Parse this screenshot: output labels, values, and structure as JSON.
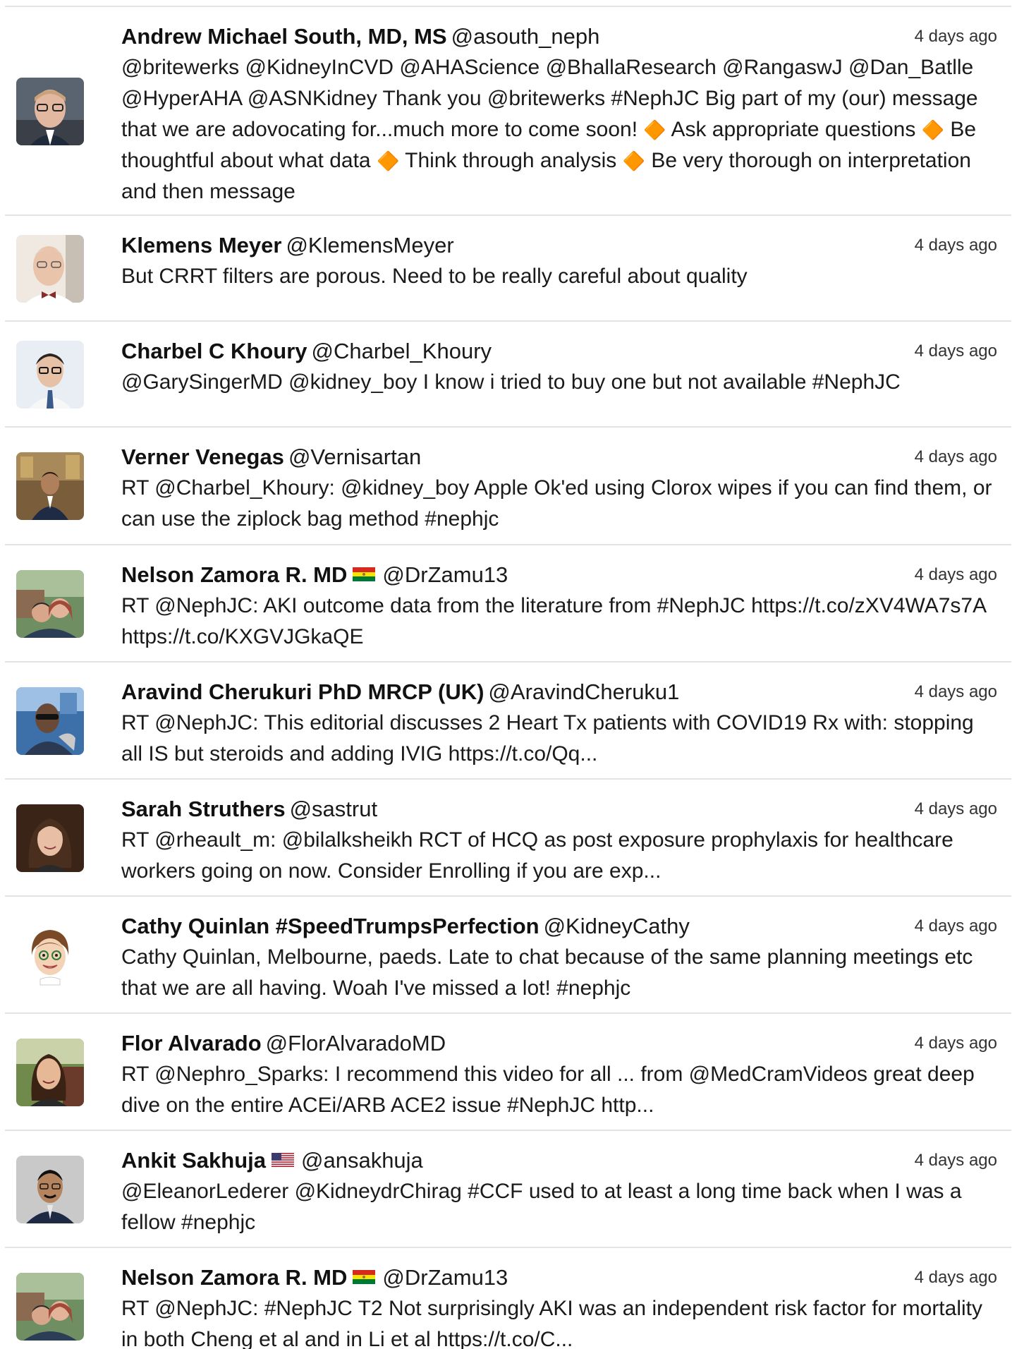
{
  "tweets": [
    {
      "name": "Andrew Michael South, MD, MS",
      "handle": "@asouth_neph",
      "time": "4 days ago",
      "text_parts": [
        "@britewerks @KidneyInCVD @AHAScience @BhallaResearch @RangaswJ @Dan_Batlle @HyperAHA @ASNKidney Thank you @britewerks #NephJC Big part of my (our) message that we are adovocating for...much more to come soon! ",
        " Ask appropriate questions ",
        " Be thoughtful about what data ",
        " Think through analysis ",
        " Be very thorough on interpretation and then message"
      ],
      "diamond": "🔶",
      "avatar_icon": "man-glasses-avatar"
    },
    {
      "name": "Klemens Meyer",
      "handle": "@KlemensMeyer",
      "time": "4 days ago",
      "text": "But CRRT filters are porous. Need to be really careful about quality",
      "avatar_icon": "man-bowtie-avatar"
    },
    {
      "name": "Charbel C Khoury",
      "handle": "@Charbel_Khoury",
      "time": "4 days ago",
      "text": "@GarySingerMD @kidney_boy I know i tried to buy one but not available #NephJC",
      "avatar_icon": "man-glasses-tie-avatar"
    },
    {
      "name": "Verner Venegas",
      "handle": "@Vernisartan",
      "time": "4 days ago",
      "text": "RT @Charbel_Khoury: @kidney_boy Apple Ok'ed using Clorox wipes if you can find them, or can use the ziplock bag method #nephjc",
      "avatar_icon": "man-suit-avatar"
    },
    {
      "name": "Nelson Zamora R. MD",
      "flag": "bolivia-flag",
      "handle": "@DrZamu13",
      "time": "4 days ago",
      "text": "RT @NephJC: AKI outcome data from the literature from #NephJC https://t.co/zXV4WA7s7A https://t.co/KXGVJGkaQE",
      "avatar_icon": "couple-selfie-avatar"
    },
    {
      "name": "Aravind Cherukuri PhD MRCP (UK)",
      "handle": "@AravindCheruku1",
      "time": "4 days ago",
      "text": "RT @NephJC: This editorial discusses 2 Heart Tx patients with COVID19 Rx with: stopping all IS but steroids and adding IVIG https://t.co/Qq...",
      "avatar_icon": "man-sunglasses-avatar"
    },
    {
      "name": "Sarah Struthers",
      "handle": "@sastrut",
      "time": "4 days ago",
      "text": "RT @rheault_m: @bilalksheikh RCT of HCQ as post exposure prophylaxis for healthcare workers going on now. Consider Enrolling if you are exp...",
      "avatar_icon": "woman-smiling-avatar"
    },
    {
      "name": "Cathy Quinlan #SpeedTrumpsPerfection",
      "handle": "@KidneyCathy",
      "time": "4 days ago",
      "text": "Cathy Quinlan, Melbourne, paeds. Late to chat because of the same planning meetings etc that we are all having. Woah I've missed a lot! #nephjc",
      "avatar_icon": "cartoon-woman-avatar"
    },
    {
      "name": "Flor Alvarado",
      "handle": "@FlorAlvaradoMD",
      "time": "4 days ago",
      "text": "RT @Nephro_Sparks: I recommend this video for all ... from @MedCramVideos great deep dive on the entire ACEi/ARB ACE2 issue #NephJC http...",
      "avatar_icon": "woman-outdoors-avatar"
    },
    {
      "name": "Ankit Sakhuja",
      "flag": "usa-flag",
      "handle": "@ansakhuja",
      "time": "4 days ago",
      "text": "@EleanorLederer @KidneydrChirag #CCF used to at least a long time back when I was a fellow #nephjc",
      "avatar_icon": "man-portrait-avatar"
    },
    {
      "name": "Nelson Zamora R. MD",
      "flag": "bolivia-flag",
      "handle": "@DrZamu13",
      "time": "4 days ago",
      "text": "RT @NephJC: #NephJC T2 Not surprisingly AKI was an independent risk factor for mortality in both Cheng et al and in Li et al https://t.co/C...",
      "avatar_icon": "couple-selfie-avatar"
    }
  ]
}
